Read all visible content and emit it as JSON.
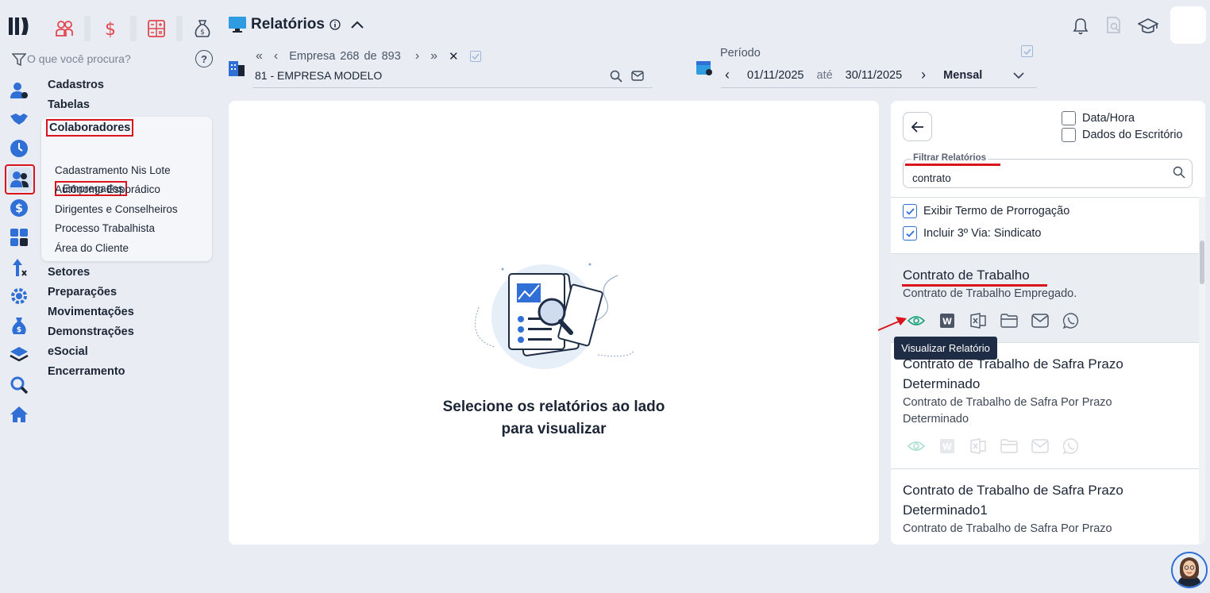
{
  "header": {
    "title": "Relatórios"
  },
  "search": {
    "placeholder": "O que você procura?"
  },
  "menu": {
    "items": [
      "Cadastros",
      "Tabelas",
      "Colaboradores",
      "Setores",
      "Preparações",
      "Movimentações",
      "Demonstrações",
      "eSocial",
      "Encerramento"
    ],
    "submenu": [
      "Empregados",
      "Cadastramento Nis Lote",
      "Autônomo Esporádico",
      "Dirigentes e Conselheiros",
      "Processo Trabalhista",
      "Área do Cliente"
    ]
  },
  "empresa": {
    "label": "Empresa",
    "current": "268",
    "of": "de",
    "total": "893",
    "name": "81 - EMPRESA MODELO"
  },
  "periodo": {
    "label": "Período",
    "start": "01/11/2025",
    "until": "até",
    "end": "30/11/2025",
    "mode": "Mensal"
  },
  "main": {
    "empty_line1": "Selecione os relatórios ao lado",
    "empty_line2": "para visualizar"
  },
  "right": {
    "opt_datahora": "Data/Hora",
    "opt_dados": "Dados do Escritório",
    "filter_label": "Filtrar Relatórios",
    "filter_value": "contrato",
    "check1": "Exibir Termo de Prorrogação",
    "check2": "Incluir 3º Via: Sindicato",
    "reports": [
      {
        "title": "Contrato de Trabalho",
        "desc": "Contrato de Trabalho Empregado."
      },
      {
        "title_l1": "Contrato de Trabalho de Safra Prazo",
        "title_l2": "Determinado",
        "desc_l1": "Contrato de Trabalho de Safra Por Prazo",
        "desc_l2": "Determinado"
      },
      {
        "title_l1": "Contrato de Trabalho de Safra Prazo",
        "title_l2": "Determinado1",
        "desc_l1": "Contrato de Trabalho de Safra Por Prazo"
      }
    ],
    "tooltip": "Visualizar Relatório"
  },
  "colors": {
    "accent_red": "#d9141c",
    "brand_blue": "#2f6fd6",
    "eye_green": "#1aa37a"
  }
}
